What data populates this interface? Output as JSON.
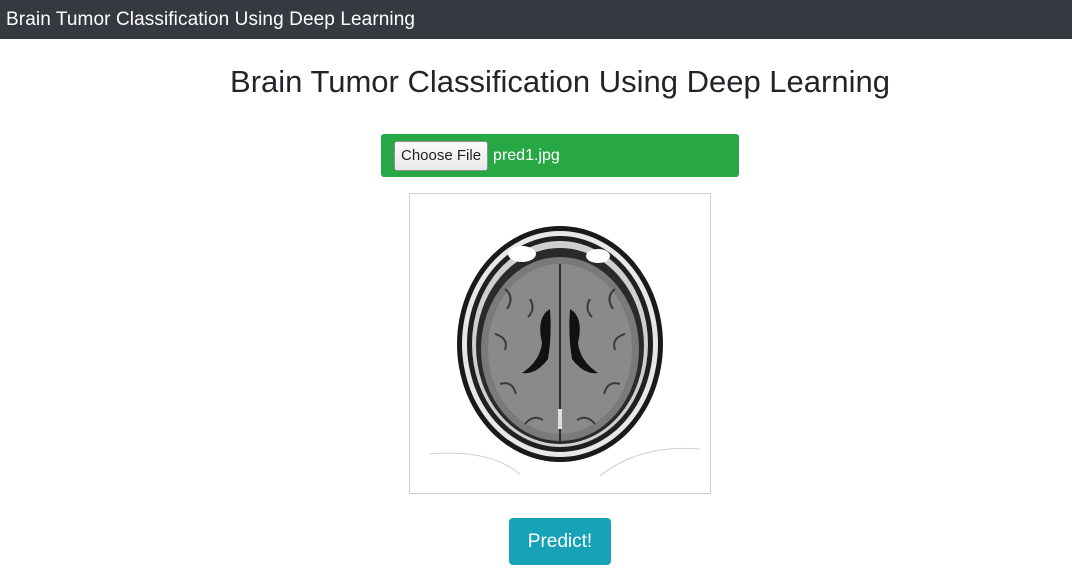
{
  "navbar": {
    "brand": "Brain Tumor Classification Using Deep Learning"
  },
  "main": {
    "title": "Brain Tumor Classification Using Deep Learning",
    "upload": {
      "choose_label": "Choose File",
      "file_name": "pred1.jpg"
    },
    "preview": {
      "subject": "brain-mri-axial-slice"
    },
    "predict_label": "Predict!"
  },
  "colors": {
    "navbar": "#343a40",
    "upload_bar": "#28a745",
    "predict_button": "#17a2b8"
  }
}
